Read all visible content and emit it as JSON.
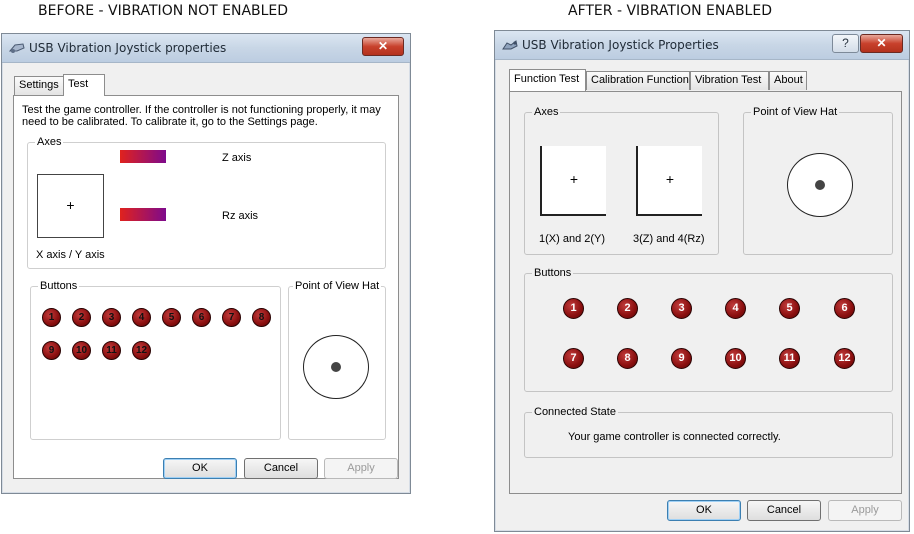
{
  "captions": {
    "before": "BEFORE -  VIBRATION NOT ENABLED",
    "after": "AFTER - VIBRATION ENABLED"
  },
  "left_window": {
    "title": "USB Vibration Joystick properties",
    "close_glyph": "✕",
    "tabs": [
      "Settings",
      "Test"
    ],
    "active_tab": "Test",
    "description": "Test the game controller.  If the controller is not functioning properly, it may need to be calibrated.  To calibrate it, go to the Settings page.",
    "axes_label": "Axes",
    "xy_label": "X axis / Y axis",
    "z_label": "Z axis",
    "rz_label": "Rz axis",
    "buttons_label": "Buttons",
    "buttons": [
      "1",
      "2",
      "3",
      "4",
      "5",
      "6",
      "7",
      "8",
      "9",
      "10",
      "11",
      "12"
    ],
    "pov_label": "Point of View Hat",
    "ok": "OK",
    "cancel": "Cancel",
    "apply": "Apply"
  },
  "right_window": {
    "title": "USB Vibration Joystick Properties",
    "help_glyph": "?",
    "close_glyph": "✕",
    "tabs": [
      "Function Test",
      "Calibration Function",
      "Vibration Test",
      "About"
    ],
    "active_tab": "Function Test",
    "axes_label": "Axes",
    "axis1_label": "1(X) and 2(Y)",
    "axis2_label": "3(Z) and 4(Rz)",
    "pov_label": "Point of View Hat",
    "buttons_label": "Buttons",
    "buttons": [
      "1",
      "2",
      "3",
      "4",
      "5",
      "6",
      "7",
      "8",
      "9",
      "10",
      "11",
      "12"
    ],
    "connected_label": "Connected State",
    "connected_message": "Your game controller is connected correctly.",
    "ok": "OK",
    "cancel": "Cancel",
    "apply": "Apply"
  },
  "colors": {
    "button_red": "#8a0f0f",
    "axis_bar_start": "#e0221d",
    "axis_bar_end": "#7e0a8c"
  }
}
